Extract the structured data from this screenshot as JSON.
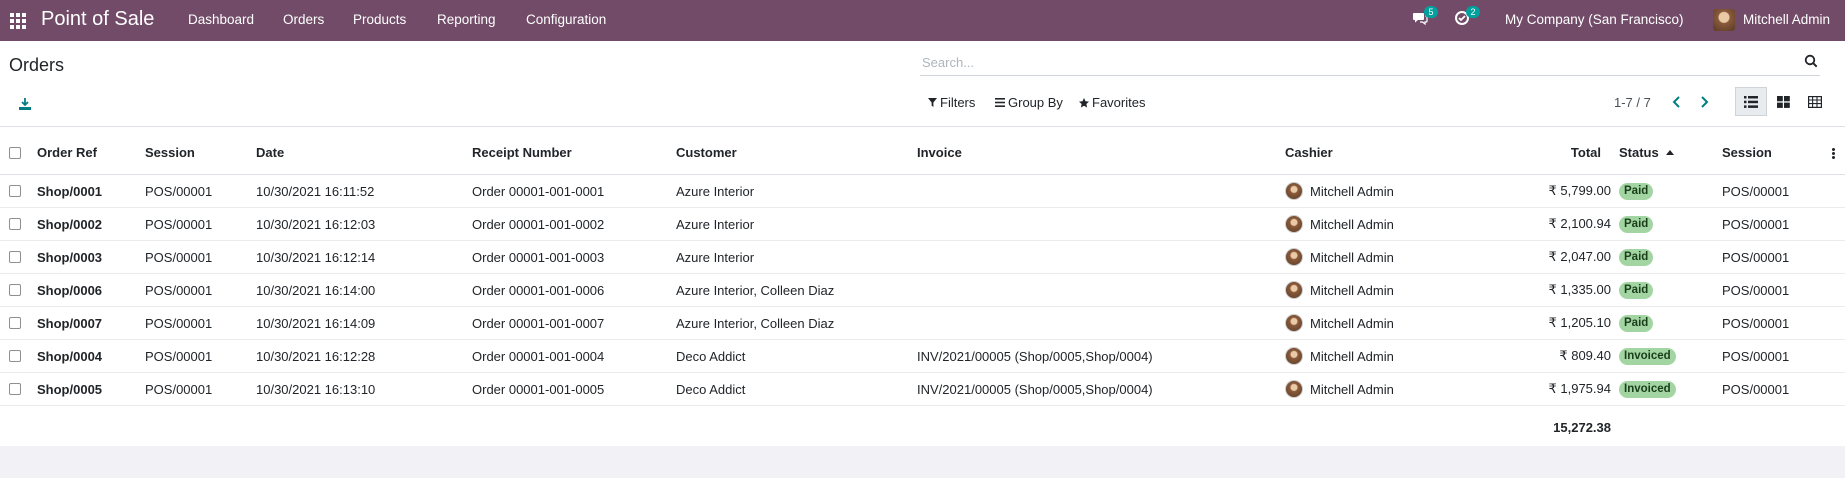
{
  "navbar": {
    "app_title": "Point of Sale",
    "menu": [
      "Dashboard",
      "Orders",
      "Products",
      "Reporting",
      "Configuration"
    ],
    "messages_count": "5",
    "activities_count": "2",
    "company": "My Company (San Francisco)",
    "user": "Mitchell Admin"
  },
  "control": {
    "breadcrumb": "Orders",
    "search_placeholder": "Search...",
    "filters_label": "Filters",
    "groupby_label": "Group By",
    "favorites_label": "Favorites",
    "pager": "1-7 / 7"
  },
  "table": {
    "headers": {
      "order_ref": "Order Ref",
      "session": "Session",
      "date": "Date",
      "receipt": "Receipt Number",
      "customer": "Customer",
      "invoice": "Invoice",
      "cashier": "Cashier",
      "total": "Total",
      "status": "Status",
      "session2": "Session"
    },
    "rows": [
      {
        "ref": "Shop/0001",
        "session": "POS/00001",
        "date": "10/30/2021 16:11:52",
        "receipt": "Order 00001-001-0001",
        "customer": "Azure Interior",
        "invoice": "",
        "cashier": "Mitchell Admin",
        "total": "₹ 5,799.00",
        "status": "Paid",
        "session2": "POS/00001"
      },
      {
        "ref": "Shop/0002",
        "session": "POS/00001",
        "date": "10/30/2021 16:12:03",
        "receipt": "Order 00001-001-0002",
        "customer": "Azure Interior",
        "invoice": "",
        "cashier": "Mitchell Admin",
        "total": "₹ 2,100.94",
        "status": "Paid",
        "session2": "POS/00001"
      },
      {
        "ref": "Shop/0003",
        "session": "POS/00001",
        "date": "10/30/2021 16:12:14",
        "receipt": "Order 00001-001-0003",
        "customer": "Azure Interior",
        "invoice": "",
        "cashier": "Mitchell Admin",
        "total": "₹ 2,047.00",
        "status": "Paid",
        "session2": "POS/00001"
      },
      {
        "ref": "Shop/0006",
        "session": "POS/00001",
        "date": "10/30/2021 16:14:00",
        "receipt": "Order 00001-001-0006",
        "customer": "Azure Interior, Colleen Diaz",
        "invoice": "",
        "cashier": "Mitchell Admin",
        "total": "₹ 1,335.00",
        "status": "Paid",
        "session2": "POS/00001"
      },
      {
        "ref": "Shop/0007",
        "session": "POS/00001",
        "date": "10/30/2021 16:14:09",
        "receipt": "Order 00001-001-0007",
        "customer": "Azure Interior, Colleen Diaz",
        "invoice": "",
        "cashier": "Mitchell Admin",
        "total": "₹ 1,205.10",
        "status": "Paid",
        "session2": "POS/00001"
      },
      {
        "ref": "Shop/0004",
        "session": "POS/00001",
        "date": "10/30/2021 16:12:28",
        "receipt": "Order 00001-001-0004",
        "customer": "Deco Addict",
        "invoice": "INV/2021/00005 (Shop/0005,Shop/0004)",
        "cashier": "Mitchell Admin",
        "total": "₹ 809.40",
        "status": "Invoiced",
        "session2": "POS/00001"
      },
      {
        "ref": "Shop/0005",
        "session": "POS/00001",
        "date": "10/30/2021 16:13:10",
        "receipt": "Order 00001-001-0005",
        "customer": "Deco Addict",
        "invoice": "INV/2021/00005 (Shop/0005,Shop/0004)",
        "cashier": "Mitchell Admin",
        "total": "₹ 1,975.94",
        "status": "Invoiced",
        "session2": "POS/00001"
      }
    ],
    "footer_total": "15,272.38"
  },
  "colors": {
    "navbar": "#714b67",
    "accent": "#017e84",
    "badge": "#00a09d",
    "paid_badge": "#a3d5a3"
  }
}
